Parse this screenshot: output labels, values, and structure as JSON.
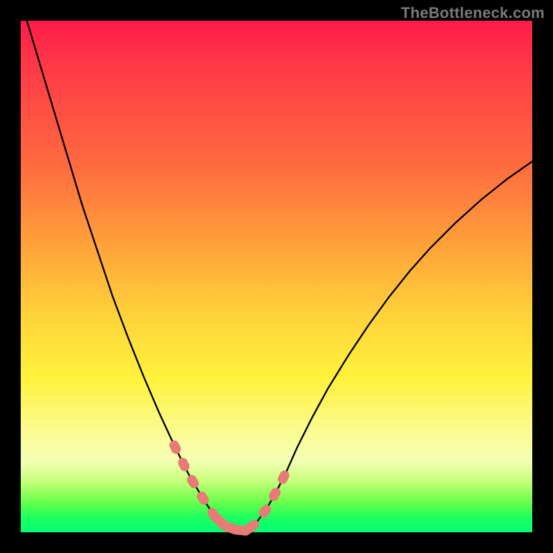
{
  "watermark": "TheBottleneck.com",
  "colors": {
    "frame": "#000000",
    "curve_line": "#000000",
    "highlight": "#e77b75",
    "gradient_stops": [
      "#ff1a4a",
      "#ff6a3f",
      "#ffd43a",
      "#fbfb8e",
      "#00ff74"
    ]
  },
  "chart_data": {
    "type": "line",
    "title": "",
    "xlabel": "",
    "ylabel": "",
    "xlim": [
      0,
      100
    ],
    "ylim": [
      0,
      100
    ],
    "grid": false,
    "legend": false,
    "curve_left": {
      "x": [
        0,
        3,
        6,
        9,
        12,
        15,
        18,
        21,
        24,
        27,
        30,
        31.5,
        33,
        34.5,
        36,
        37,
        38,
        39,
        40,
        44
      ],
      "y": [
        104,
        94,
        84,
        74,
        64,
        55,
        46,
        38,
        30.5,
        23.5,
        17,
        14,
        11,
        8.5,
        6,
        4.5,
        3,
        2,
        1.2,
        0.3
      ]
    },
    "curve_right": {
      "x": [
        44,
        46,
        48,
        50,
        52,
        54,
        57,
        60,
        64,
        68,
        72,
        76,
        80,
        85,
        90,
        95,
        100
      ],
      "y": [
        0.3,
        1.8,
        4.5,
        8.0,
        12,
        16.5,
        22.5,
        28,
        34.5,
        40.5,
        46,
        51,
        55.5,
        60.5,
        65,
        69,
        72.5
      ]
    },
    "highlight_left": {
      "x": [
        30,
        31.5,
        33,
        34.5,
        36,
        37,
        38
      ],
      "y": [
        17,
        14,
        11,
        8.5,
        6,
        4.5,
        3
      ]
    },
    "highlight_right": {
      "x": [
        45,
        46,
        48,
        50,
        52
      ],
      "y": [
        1.0,
        1.8,
        4.5,
        8.0,
        12
      ]
    },
    "highlight_bottom": {
      "x": [
        38,
        40,
        42,
        44,
        45
      ],
      "y": [
        3,
        1.2,
        0.5,
        0.3,
        1.0
      ]
    }
  }
}
